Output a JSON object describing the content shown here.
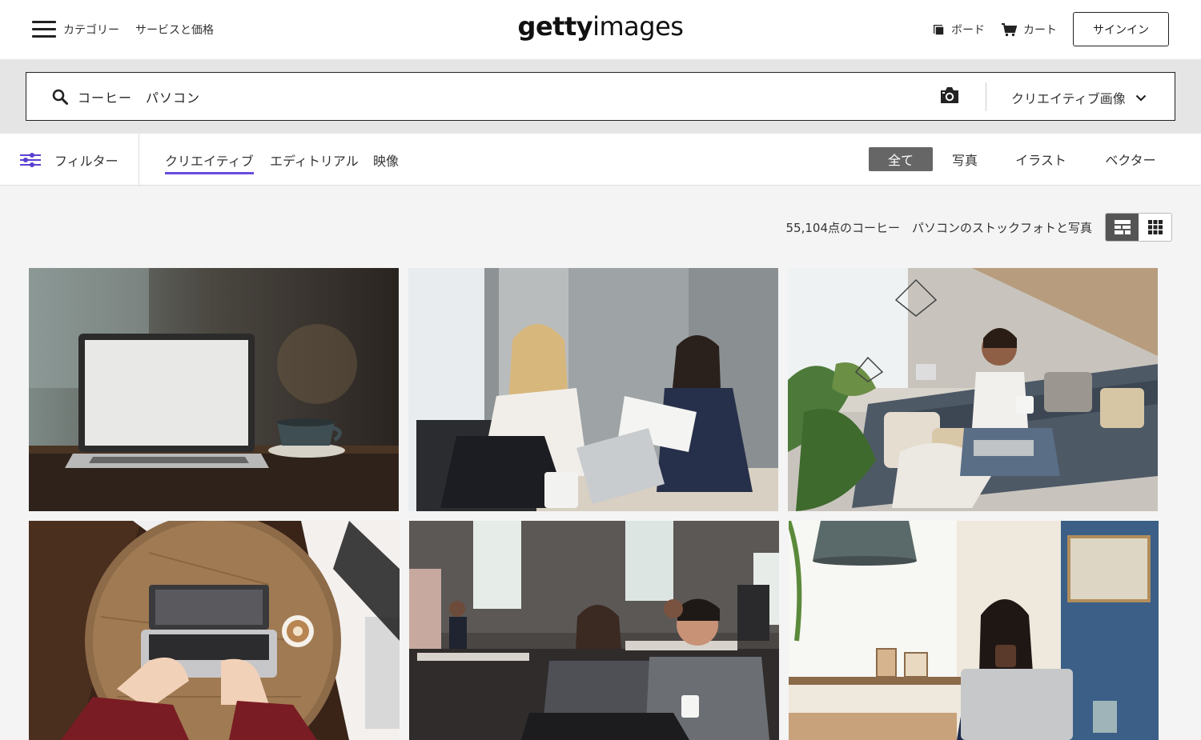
{
  "header": {
    "menu_label": "カテゴリー",
    "services_label": "サービスと価格",
    "logo_bold": "getty",
    "logo_light": "images",
    "board_label": "ボード",
    "cart_label": "カート",
    "signin_label": "サインイン"
  },
  "search": {
    "query": "コーヒー　パソコン",
    "type_label": "クリエイティブ画像"
  },
  "filters": {
    "filter_label": "フィルター",
    "tabs": [
      {
        "label": "クリエイティブ",
        "active": true
      },
      {
        "label": "エディトリアル",
        "active": false
      },
      {
        "label": "映像",
        "active": false
      }
    ],
    "types": [
      {
        "label": "全て",
        "active": true
      },
      {
        "label": "写真",
        "active": false
      },
      {
        "label": "イラスト",
        "active": false
      },
      {
        "label": "ベクター",
        "active": false
      }
    ]
  },
  "results": {
    "count_text": "55,104点のコーヒー　パソコンのストックフォトと写真",
    "view_mode": "mosaic"
  },
  "colors": {
    "accent": "#6a4cdc",
    "active_pill": "#666666",
    "search_band": "#e5e5e5"
  },
  "icons": [
    "hamburger-icon",
    "board-icon",
    "cart-icon",
    "search-icon",
    "camera-icon",
    "chevron-down-icon",
    "filter-sliders-icon",
    "mosaic-view-icon",
    "grid-view-icon"
  ]
}
